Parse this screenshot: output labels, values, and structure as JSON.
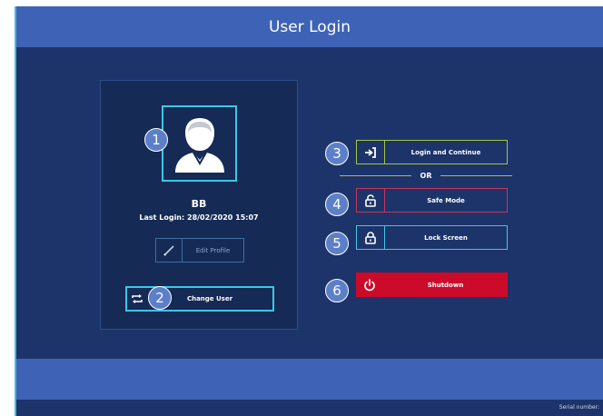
{
  "header": {
    "title": "User Login"
  },
  "profile": {
    "user_name": "BB",
    "last_login_label": "Last Login:",
    "last_login_value": "28/02/2020 15:07",
    "edit_profile_label": "Edit Profile",
    "change_user_label": "Change User"
  },
  "actions": {
    "login_continue_label": "Login and Continue",
    "or_label": "OR",
    "safe_mode_label": "Safe Mode",
    "lock_screen_label": "Lock Screen",
    "shutdown_label": "Shutdown"
  },
  "badges": [
    "1",
    "2",
    "3",
    "4",
    "5",
    "6"
  ],
  "footer": {
    "serial_label": "Serial number:"
  },
  "colors": {
    "background": "#1c3469",
    "header": "#3e63b6",
    "accent_cyan": "#3ec6e6",
    "accent_green": "#a4c545",
    "accent_red": "#c8335c",
    "shutdown_red": "#cc0a2a",
    "divider_gold": "#c9b22f"
  },
  "icons": {
    "avatar": "user-avatar-icon",
    "edit": "pencil-icon",
    "change_user": "swap-icon",
    "login": "sign-in-icon",
    "safe_mode": "unlock-icon",
    "lock": "lock-icon",
    "shutdown": "power-icon"
  }
}
